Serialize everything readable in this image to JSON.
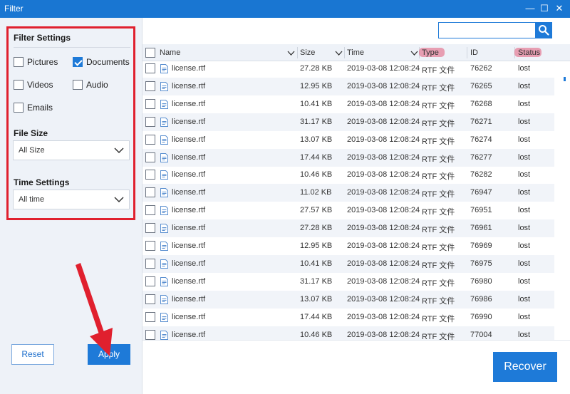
{
  "window": {
    "title": "Filter",
    "minimize_glyph": "—",
    "maximize_glyph": "☐",
    "close_glyph": "✕"
  },
  "sidebar": {
    "filter_settings_title": "Filter Settings",
    "types": [
      {
        "label": "Pictures",
        "checked": false
      },
      {
        "label": "Documents",
        "checked": true
      },
      {
        "label": "Videos",
        "checked": false
      },
      {
        "label": "Audio",
        "checked": false
      },
      {
        "label": "Emails",
        "checked": false
      }
    ],
    "file_size_title": "File Size",
    "file_size_value": "All Size",
    "time_settings_title": "Time Settings",
    "time_value": "All time",
    "reset_label": "Reset",
    "apply_label": "Apply"
  },
  "search": {
    "placeholder": "",
    "icon": "search-icon"
  },
  "table": {
    "columns": [
      "Name",
      "Size",
      "Time",
      "Type",
      "ID",
      "Status"
    ],
    "rows": [
      {
        "name": "license.rtf",
        "size": "27.28 KB",
        "time": "2019-03-08 12:08:24",
        "type": "RTF 文件",
        "id": "76262",
        "status": "lost"
      },
      {
        "name": "license.rtf",
        "size": "12.95 KB",
        "time": "2019-03-08 12:08:24",
        "type": "RTF 文件",
        "id": "76265",
        "status": "lost"
      },
      {
        "name": "license.rtf",
        "size": "10.41 KB",
        "time": "2019-03-08 12:08:24",
        "type": "RTF 文件",
        "id": "76268",
        "status": "lost"
      },
      {
        "name": "license.rtf",
        "size": "31.17 KB",
        "time": "2019-03-08 12:08:24",
        "type": "RTF 文件",
        "id": "76271",
        "status": "lost"
      },
      {
        "name": "license.rtf",
        "size": "13.07 KB",
        "time": "2019-03-08 12:08:24",
        "type": "RTF 文件",
        "id": "76274",
        "status": "lost"
      },
      {
        "name": "license.rtf",
        "size": "17.44 KB",
        "time": "2019-03-08 12:08:24",
        "type": "RTF 文件",
        "id": "76277",
        "status": "lost"
      },
      {
        "name": "license.rtf",
        "size": "10.46 KB",
        "time": "2019-03-08 12:08:24",
        "type": "RTF 文件",
        "id": "76282",
        "status": "lost"
      },
      {
        "name": "license.rtf",
        "size": "11.02 KB",
        "time": "2019-03-08 12:08:24",
        "type": "RTF 文件",
        "id": "76947",
        "status": "lost"
      },
      {
        "name": "license.rtf",
        "size": "27.57 KB",
        "time": "2019-03-08 12:08:24",
        "type": "RTF 文件",
        "id": "76951",
        "status": "lost"
      },
      {
        "name": "license.rtf",
        "size": "27.28 KB",
        "time": "2019-03-08 12:08:24",
        "type": "RTF 文件",
        "id": "76961",
        "status": "lost"
      },
      {
        "name": "license.rtf",
        "size": "12.95 KB",
        "time": "2019-03-08 12:08:24",
        "type": "RTF 文件",
        "id": "76969",
        "status": "lost"
      },
      {
        "name": "license.rtf",
        "size": "10.41 KB",
        "time": "2019-03-08 12:08:24",
        "type": "RTF 文件",
        "id": "76975",
        "status": "lost"
      },
      {
        "name": "license.rtf",
        "size": "31.17 KB",
        "time": "2019-03-08 12:08:24",
        "type": "RTF 文件",
        "id": "76980",
        "status": "lost"
      },
      {
        "name": "license.rtf",
        "size": "13.07 KB",
        "time": "2019-03-08 12:08:24",
        "type": "RTF 文件",
        "id": "76986",
        "status": "lost"
      },
      {
        "name": "license.rtf",
        "size": "17.44 KB",
        "time": "2019-03-08 12:08:24",
        "type": "RTF 文件",
        "id": "76990",
        "status": "lost"
      },
      {
        "name": "license.rtf",
        "size": "10.46 KB",
        "time": "2019-03-08 12:08:24",
        "type": "RTF 文件",
        "id": "77004",
        "status": "lost"
      }
    ]
  },
  "recover_label": "Recover",
  "colors": {
    "accent": "#1e7ad8",
    "annotation": "#e0202e"
  }
}
